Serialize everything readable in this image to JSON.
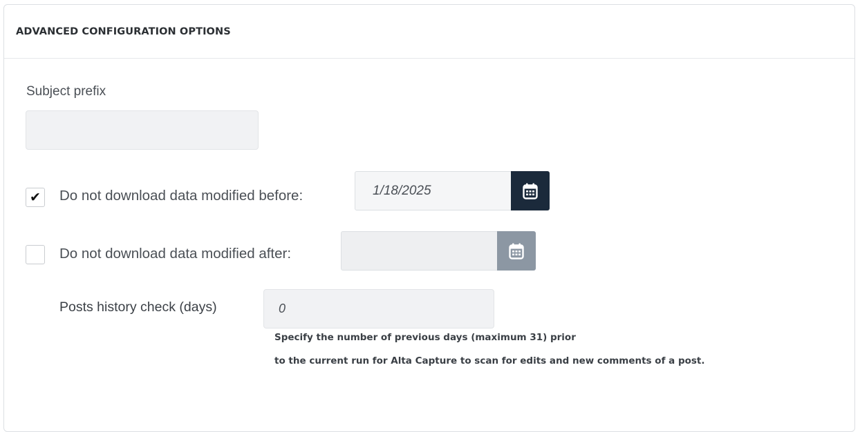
{
  "panel": {
    "title": "ADVANCED CONFIGURATION OPTIONS"
  },
  "subject_prefix": {
    "label": "Subject prefix",
    "value": ""
  },
  "modified_before": {
    "checked": true,
    "checkmark": "✔",
    "label": "Do not download data modified before:",
    "value": "1/18/2025",
    "calendar_icon": "calendar-icon",
    "button_color": "#1b2a3b"
  },
  "modified_after": {
    "checked": false,
    "label": "Do not download data modified after:",
    "value": "",
    "calendar_icon": "calendar-icon",
    "button_color": "#8c97a3"
  },
  "posts_history": {
    "label": "Posts history check (days)",
    "value": "0",
    "help_line1": "Specify the number of previous days (maximum 31) prior",
    "help_line2": "to the current run for Alta Capture to scan for edits and new comments of a post."
  }
}
